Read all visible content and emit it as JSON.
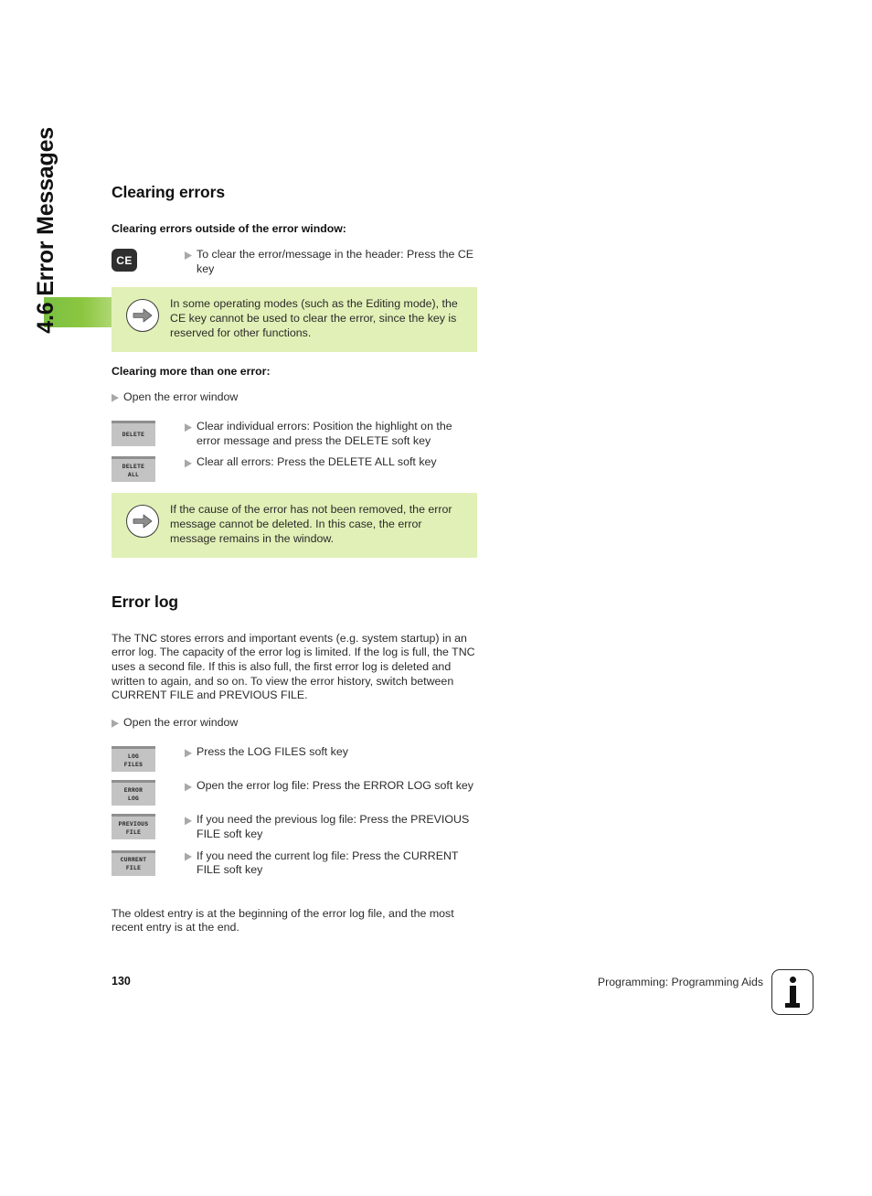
{
  "chapter_tab": {
    "label": "4.6 Error Messages",
    "accent_color": "#7ac143"
  },
  "section": {
    "title": "Clearing errors",
    "sub_outside": "Clearing errors outside of the error window:",
    "sub_more": "Clearing more than one error:"
  },
  "steps_outside": [
    {
      "key_type": "hardkey",
      "key_label": "CE",
      "text": "To clear the error/message in the header: Press the CE key"
    }
  ],
  "note_ce": {
    "icon": "arrow-right-circle-icon",
    "text": "In some operating modes (such as the Editing mode), the CE key cannot be used to clear the error, since the key is reserved for other functions."
  },
  "steps_more": [
    {
      "key_type": "none",
      "text": "Open the error window"
    },
    {
      "key_type": "softkey",
      "key_line1": "DELETE",
      "key_line2": "",
      "text": "Clear individual errors: Position the highlight on the error message and press the DELETE soft key"
    },
    {
      "key_type": "softkey",
      "key_line1": "DELETE",
      "key_line2": "ALL",
      "text": "Clear all errors: Press the DELETE ALL soft key"
    }
  ],
  "note_cause": {
    "icon": "arrow-right-circle-icon",
    "text": "If the cause of the error has not been removed, the error message cannot be deleted. In this case, the error message remains in the window."
  },
  "error_log": {
    "title": "Error log",
    "paragraph": "The TNC stores errors and important events (e.g. system startup) in an error log. The capacity of the error log is limited. If the log is full, the TNC uses a second file. If this is also full, the first error log is deleted and written to again, and so on. To view the error history, switch between CURRENT FILE and PREVIOUS FILE.",
    "closing": "The oldest entry is at the beginning of the error log file, and the most recent entry is at the end."
  },
  "steps_log": [
    {
      "key_type": "none",
      "text": "Open the error window"
    },
    {
      "key_type": "softkey",
      "key_line1": "LOG",
      "key_line2": "FILES",
      "text": "Press the LOG FILES soft key"
    },
    {
      "key_type": "softkey",
      "key_line1": "ERROR",
      "key_line2": "LOG",
      "text": "Open the error log file: Press the ERROR LOG soft key"
    },
    {
      "key_type": "softkey",
      "key_line1": "PREVIOUS",
      "key_line2": "FILE",
      "text": "If you need the previous log file: Press the PREVIOUS FILE soft key"
    },
    {
      "key_type": "softkey",
      "key_line1": "CURRENT",
      "key_line2": "FILE",
      "text": "If you need the current log file: Press the CURRENT FILE soft key"
    }
  ],
  "footer": {
    "page_number": "130",
    "running_head": "Programming: Programming Aids",
    "info_icon": "info-key-icon"
  }
}
